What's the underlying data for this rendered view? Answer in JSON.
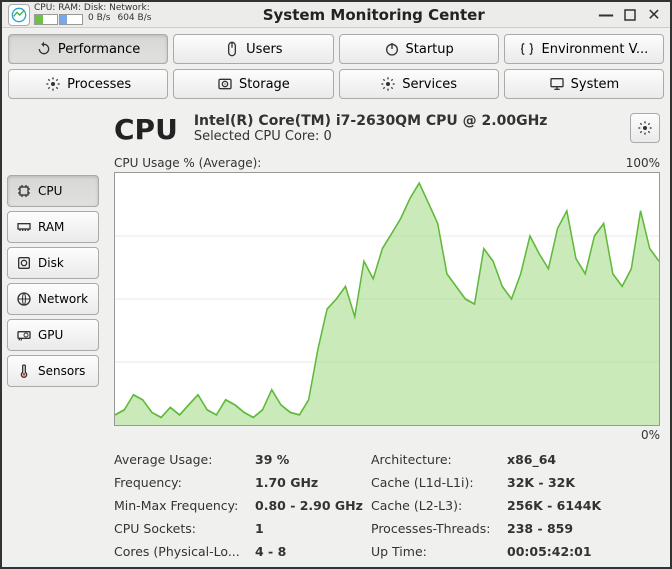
{
  "titlebar": {
    "mini_labels": "CPU: RAM: Disk: Network:",
    "disk_rate": "0 B/s",
    "net_rate": "604 B/s",
    "title": "System Monitoring Center"
  },
  "tabs": [
    {
      "label": "Performance"
    },
    {
      "label": "Users"
    },
    {
      "label": "Startup"
    },
    {
      "label": "Environment V..."
    },
    {
      "label": "Processes"
    },
    {
      "label": "Storage"
    },
    {
      "label": "Services"
    },
    {
      "label": "System"
    }
  ],
  "sidebar": [
    {
      "label": "CPU"
    },
    {
      "label": "RAM"
    },
    {
      "label": "Disk"
    },
    {
      "label": "Network"
    },
    {
      "label": "GPU"
    },
    {
      "label": "Sensors"
    }
  ],
  "header": {
    "title": "CPU",
    "model": "Intel(R) Core(TM) i7-2630QM CPU @ 2.00GHz",
    "selected": "Selected CPU Core: 0"
  },
  "chart": {
    "label": "CPU Usage % (Average):",
    "max": "100%",
    "min": "0%"
  },
  "info": {
    "avg_usage_l": "Average Usage:",
    "avg_usage_v": "39 %",
    "arch_l": "Architecture:",
    "arch_v": "x86_64",
    "freq_l": "Frequency:",
    "freq_v": "1.70 GHz",
    "cache1_l": "Cache (L1d-L1i):",
    "cache1_v": "32K - 32K",
    "minmax_l": "Min-Max Frequency:",
    "minmax_v": "0.80 - 2.90 GHz",
    "cache2_l": "Cache (L2-L3):",
    "cache2_v": "256K - 6144K",
    "sockets_l": "CPU Sockets:",
    "sockets_v": "1",
    "procthr_l": "Processes-Threads:",
    "procthr_v": "238 - 859",
    "cores_l": "Cores (Physical-Lo...",
    "cores_v": "4 - 8",
    "uptime_l": "Up Time:",
    "uptime_v": "00:05:42:01"
  },
  "chart_data": {
    "type": "area",
    "title": "CPU Usage % (Average)",
    "ylabel": "CPU Usage %",
    "ylim": [
      0,
      100
    ],
    "x": [
      0,
      1,
      2,
      3,
      4,
      5,
      6,
      7,
      8,
      9,
      10,
      11,
      12,
      13,
      14,
      15,
      16,
      17,
      18,
      19,
      20,
      21,
      22,
      23,
      24,
      25,
      26,
      27,
      28,
      29,
      30,
      31,
      32,
      33,
      34,
      35,
      36,
      37,
      38,
      39,
      40,
      41,
      42,
      43,
      44,
      45,
      46,
      47,
      48,
      49,
      50,
      51,
      52,
      53,
      54,
      55,
      56,
      57,
      58,
      59
    ],
    "values": [
      4,
      6,
      12,
      10,
      5,
      3,
      7,
      4,
      8,
      12,
      6,
      4,
      10,
      8,
      5,
      3,
      6,
      14,
      8,
      5,
      4,
      10,
      30,
      46,
      50,
      55,
      43,
      65,
      58,
      70,
      76,
      82,
      90,
      96,
      88,
      80,
      60,
      55,
      50,
      48,
      70,
      65,
      55,
      50,
      60,
      75,
      68,
      62,
      78,
      85,
      66,
      60,
      75,
      80,
      60,
      55,
      62,
      85,
      70,
      65
    ]
  }
}
